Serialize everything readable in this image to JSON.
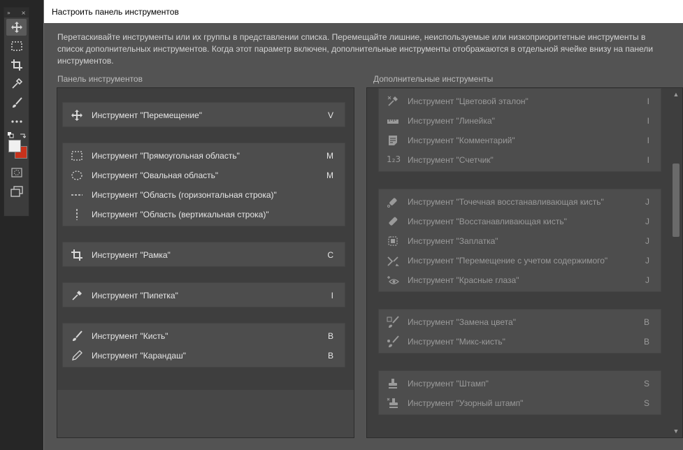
{
  "toolbar": {
    "collapse_label": "»",
    "close_label": "×",
    "buttons": [
      {
        "icon": "move-icon"
      },
      {
        "icon": "rect-marquee-icon"
      },
      {
        "icon": "crop-icon"
      },
      {
        "icon": "eyedropper-icon"
      },
      {
        "icon": "brush-icon"
      },
      {
        "icon": "more-icon"
      },
      {
        "icon": "quick-mask-icon"
      },
      {
        "icon": "screen-mode-icon"
      }
    ],
    "foreground_color": "#f0f0f0",
    "background_color": "#c8321c"
  },
  "dialog": {
    "title": "Настроить панель инструментов",
    "description": "Перетаскивайте инструменты или их группы в представлении списка. Перемещайте лишние, неиспользуемые или низкоприоритетные инструменты в список дополнительных инструментов. Когда этот параметр включен, дополнительные инструменты отображаются в отдельной ячейке внизу на панели инструментов.",
    "left_label": "Панель инструментов",
    "right_label": "Дополнительные инструменты"
  },
  "left_groups": [
    {
      "items": [
        {
          "icon": "move-icon",
          "label": "Инструмент \"Перемещение\"",
          "key": "V"
        }
      ]
    },
    {
      "items": [
        {
          "icon": "rect-marquee-icon",
          "label": "Инструмент \"Прямоугольная область\"",
          "key": "M"
        },
        {
          "icon": "ellipse-marquee-icon",
          "label": "Инструмент \"Овальная область\"",
          "key": "M"
        },
        {
          "icon": "single-row-marquee-icon",
          "label": "Инструмент \"Область (горизонтальная строка)\"",
          "key": ""
        },
        {
          "icon": "single-column-marquee-icon",
          "label": "Инструмент \"Область (вертикальная строка)\"",
          "key": ""
        }
      ]
    },
    {
      "items": [
        {
          "icon": "crop-icon",
          "label": "Инструмент \"Рамка\"",
          "key": "C"
        }
      ]
    },
    {
      "items": [
        {
          "icon": "eyedropper-icon",
          "label": "Инструмент \"Пипетка\"",
          "key": "I"
        }
      ]
    },
    {
      "items": [
        {
          "icon": "brush-icon",
          "label": "Инструмент \"Кисть\"",
          "key": "B"
        },
        {
          "icon": "pencil-icon",
          "label": "Инструмент \"Карандаш\"",
          "key": "B"
        }
      ]
    }
  ],
  "right_groups": [
    {
      "items": [
        {
          "icon": "color-sampler-icon",
          "label": "Инструмент \"Цветовой эталон\"",
          "key": "I"
        },
        {
          "icon": "ruler-icon",
          "label": "Инструмент \"Линейка\"",
          "key": "I"
        },
        {
          "icon": "note-icon",
          "label": "Инструмент \"Комментарий\"",
          "key": "I"
        },
        {
          "icon": "count-icon",
          "icon_text": "1₂3",
          "label": "Инструмент \"Счетчик\"",
          "key": "I"
        }
      ]
    },
    {
      "items": [
        {
          "icon": "spot-healing-brush-icon",
          "label": "Инструмент \"Точечная восстанавливающая кисть\"",
          "key": "J"
        },
        {
          "icon": "healing-brush-icon",
          "label": "Инструмент \"Восстанавливающая кисть\"",
          "key": "J"
        },
        {
          "icon": "patch-icon",
          "label": "Инструмент \"Заплатка\"",
          "key": "J"
        },
        {
          "icon": "content-aware-move-icon",
          "label": "Инструмент \"Перемещение с учетом содержимого\"",
          "key": "J"
        },
        {
          "icon": "red-eye-icon",
          "label": "Инструмент \"Красные глаза\"",
          "key": "J"
        }
      ]
    },
    {
      "items": [
        {
          "icon": "color-replacement-icon",
          "label": "Инструмент \"Замена цвета\"",
          "key": "B"
        },
        {
          "icon": "mixer-brush-icon",
          "label": "Инструмент \"Микс-кисть\"",
          "key": "B"
        }
      ]
    },
    {
      "items": [
        {
          "icon": "clone-stamp-icon",
          "label": "Инструмент \"Штамп\"",
          "key": "S"
        },
        {
          "icon": "pattern-stamp-icon",
          "label": "Инструмент \"Узорный штамп\"",
          "key": "S"
        }
      ]
    }
  ],
  "scrollbar": {
    "up_arrow": "▲",
    "down_arrow": "▼"
  }
}
